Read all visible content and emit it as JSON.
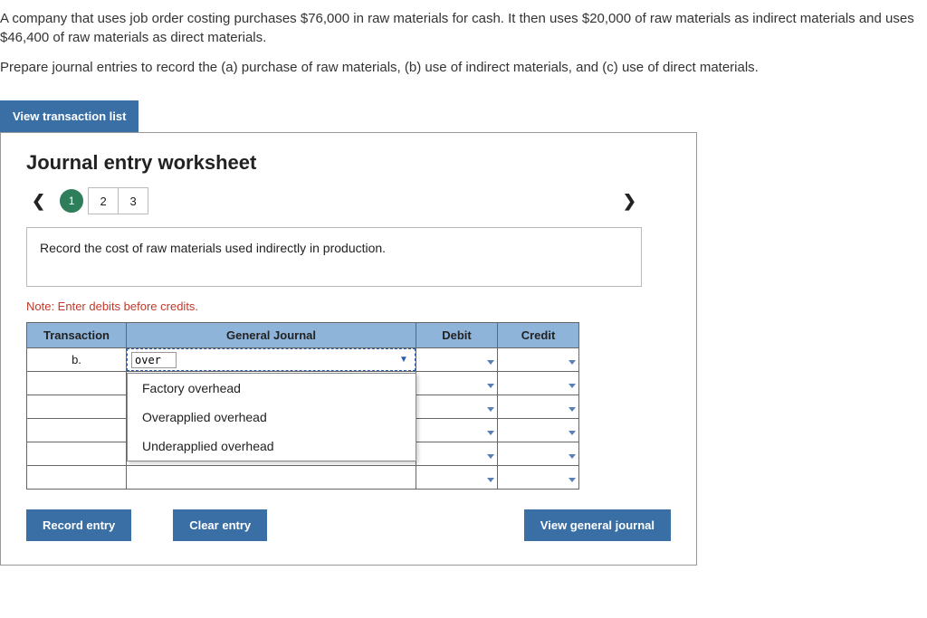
{
  "question": {
    "para1": "A company that uses job order costing purchases $76,000 in raw materials for cash. It then uses $20,000 of raw materials as indirect materials and uses $46,400 of raw materials as direct materials.",
    "para2": "Prepare journal entries to record the (a) purchase of raw materials, (b) use of indirect materials, and (c) use of direct materials."
  },
  "buttons": {
    "view_list": "View transaction list",
    "record_entry": "Record entry",
    "clear_entry": "Clear entry",
    "view_journal": "View general journal"
  },
  "worksheet": {
    "title": "Journal entry worksheet",
    "steps": [
      "1",
      "2",
      "3"
    ],
    "instruction": "Record the cost of raw materials used indirectly in production.",
    "note": "Note: Enter debits before credits.",
    "headers": {
      "transaction": "Transaction",
      "journal": "General Journal",
      "debit": "Debit",
      "credit": "Credit"
    },
    "row1": {
      "transaction": "b.",
      "input_value": "over"
    },
    "dropdown_options": [
      "Factory overhead",
      "Overapplied overhead",
      "Underapplied overhead"
    ]
  }
}
